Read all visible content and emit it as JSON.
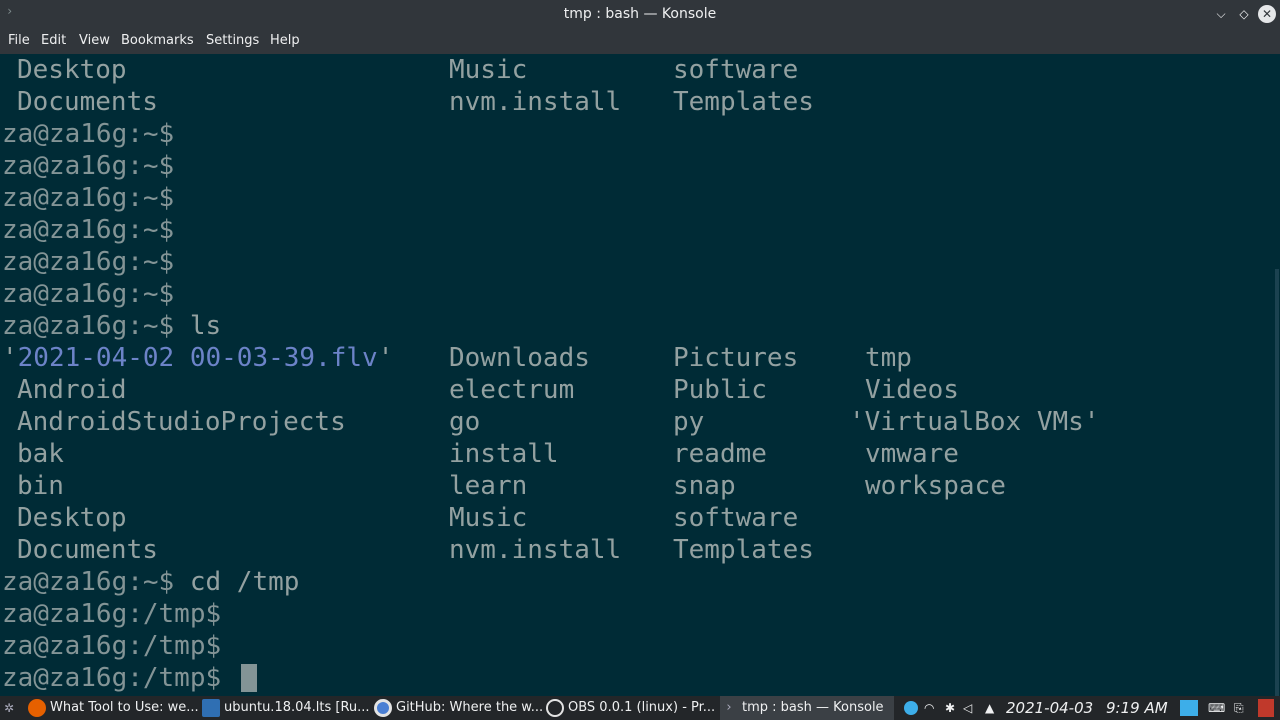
{
  "window": {
    "title": "tmp : bash — Konsole"
  },
  "menu": [
    "File",
    "Edit",
    "View",
    "Bookmarks",
    "Settings",
    "Help"
  ],
  "terminal": {
    "top_rows": [
      [
        "Desktop",
        "Music",
        "software",
        ""
      ],
      [
        "Documents",
        "nvm.install",
        "Templates",
        ""
      ]
    ],
    "prompts_home": [
      "za@za16g:~$",
      "za@za16g:~$",
      "za@za16g:~$",
      "za@za16g:~$",
      "za@za16g:~$",
      "za@za16g:~$"
    ],
    "ls_prompt": "za@za16g:~$",
    "ls_command": " ls",
    "ls_first_row": {
      "quote_open": "'",
      "file": "2021-04-02 00-03-39.flv",
      "quote_close": "'",
      "col2": "Downloads",
      "col3": "Pictures",
      "col4": "tmp"
    },
    "ls_rows": [
      [
        "Android",
        "electrum",
        "Public",
        "Videos"
      ],
      [
        "AndroidStudioProjects",
        "go",
        "py",
        "'VirtualBox VMs'"
      ],
      [
        "bak",
        "install",
        "readme",
        "vmware"
      ],
      [
        "bin",
        "learn",
        "snap",
        "workspace"
      ],
      [
        "Desktop",
        "Music",
        "software",
        ""
      ],
      [
        "Documents",
        "nvm.install",
        "Templates",
        ""
      ]
    ],
    "cd_prompt": "za@za16g:~$",
    "cd_command": " cd /tmp",
    "tmp_prompts": [
      "za@za16g:/tmp$",
      "za@za16g:/tmp$",
      "za@za16g:/tmp$"
    ]
  },
  "taskbar": {
    "tasks": [
      {
        "label": "What Tool to Use: we...",
        "icon": "firefox-icon"
      },
      {
        "label": "ubuntu.18.04.lts [Ru...",
        "icon": "virtualbox-icon"
      },
      {
        "label": "GitHub: Where the w...",
        "icon": "chrome-icon"
      },
      {
        "label": "OBS 0.0.1 (linux) - Pr...",
        "icon": "obs-icon"
      },
      {
        "label": "tmp : bash — Konsole",
        "icon": "konsole-icon"
      }
    ],
    "date": "2021-04-03",
    "time": "9:19 AM"
  }
}
